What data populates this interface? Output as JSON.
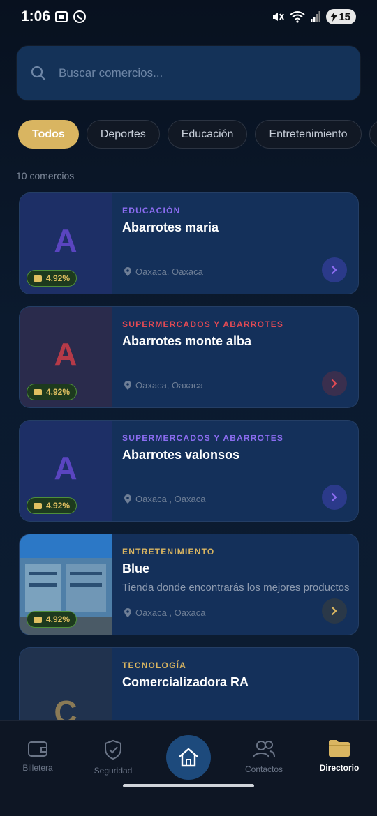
{
  "status": {
    "time": "1:06",
    "battery": "15"
  },
  "search": {
    "placeholder": "Buscar comercios..."
  },
  "chips": [
    "Todos",
    "Deportes",
    "Educación",
    "Entretenimiento",
    "H"
  ],
  "count_label": "10 comercios",
  "cards": [
    {
      "letter": "A",
      "category": "EDUCACIÓN",
      "name": "Abarrotes maria",
      "description": "",
      "location": "Oaxaca, Oaxaca",
      "cashback": "4.92%",
      "accent": "#8b6cf0",
      "letter_color": "#5a45c0",
      "thumb_bg": "#1d2f66"
    },
    {
      "letter": "A",
      "category": "SUPERMERCADOS Y ABARROTES",
      "name": "Abarrotes monte alba",
      "description": "",
      "location": "Oaxaca, Oaxaca",
      "cashback": "4.92%",
      "accent": "#e24a54",
      "letter_color": "#b53a48",
      "thumb_bg": "#2a2b4c"
    },
    {
      "letter": "A",
      "category": "SUPERMERCADOS Y ABARROTES",
      "name": "Abarrotes valonsos",
      "description": "",
      "location": "Oaxaca , Oaxaca",
      "cashback": "4.92%",
      "accent": "#8b6cf0",
      "letter_color": "#5a45c0",
      "thumb_bg": "#1d2f66"
    },
    {
      "letter": "",
      "category": "ENTRETENIMIENTO",
      "name": "Blue",
      "description": "Tienda donde encontrarás los mejores productos",
      "location": "Oaxaca , Oaxaca",
      "cashback": "4.92%",
      "accent": "#d9b561",
      "letter_color": "#ffffff",
      "thumb_bg": "#2a6db0"
    },
    {
      "letter": "C",
      "category": "TECNOLOGÍA",
      "name": "Comercializadora RA",
      "description": "",
      "location": "",
      "cashback": "",
      "accent": "#d9b561",
      "letter_color": "#8a7a56",
      "thumb_bg": "#20324e"
    }
  ],
  "nav": {
    "wallet": "Billetera",
    "security": "Seguridad",
    "contacts": "Contactos",
    "directory": "Directorio"
  }
}
